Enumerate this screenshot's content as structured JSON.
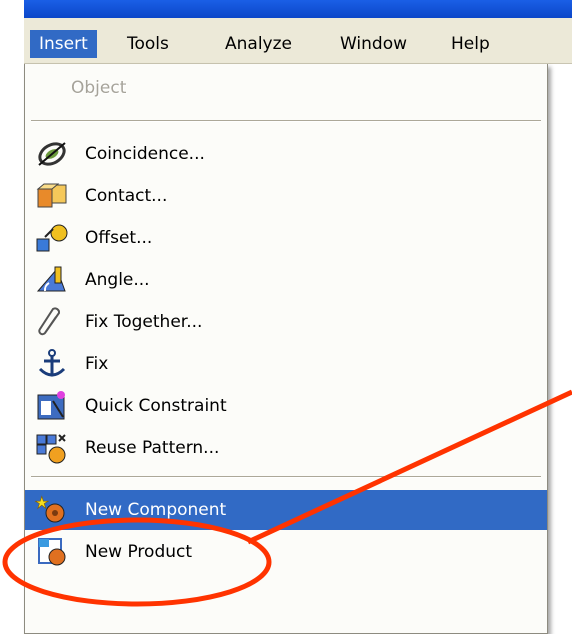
{
  "menubar": {
    "items": [
      {
        "label": "Insert",
        "mnemonic": "I",
        "rest": "nsert"
      },
      {
        "label": "Tools",
        "mnemonic": "T",
        "rest": "ools"
      },
      {
        "label": "Analyze",
        "mnemonic": "A",
        "rest": "nalyze"
      },
      {
        "label": "Window",
        "mnemonic": "W",
        "rest": "indow"
      },
      {
        "label": "Help",
        "mnemonic": "H",
        "rest": "elp"
      }
    ]
  },
  "menu": {
    "disabled_item": "Object",
    "items": [
      {
        "label": "Coincidence...",
        "icon": "coincidence-icon"
      },
      {
        "label": "Contact...",
        "icon": "contact-icon"
      },
      {
        "label": "Offset...",
        "icon": "offset-icon"
      },
      {
        "label": "Angle...",
        "icon": "angle-icon"
      },
      {
        "label": "Fix Together...",
        "icon": "paperclip-icon"
      },
      {
        "label": "Fix",
        "icon": "anchor-icon"
      },
      {
        "label": "Quick Constraint",
        "icon": "quick-constraint-icon"
      },
      {
        "label": "Reuse Pattern...",
        "icon": "reuse-pattern-icon"
      }
    ],
    "lower_items": [
      {
        "label": "New Component",
        "icon": "new-component-icon",
        "highlighted": true
      },
      {
        "label": "New Product",
        "icon": "new-product-icon"
      }
    ]
  },
  "colors": {
    "menu_highlight": "#316ac5",
    "annotation": "#ff3300",
    "titlebar": "#0b46c8"
  }
}
